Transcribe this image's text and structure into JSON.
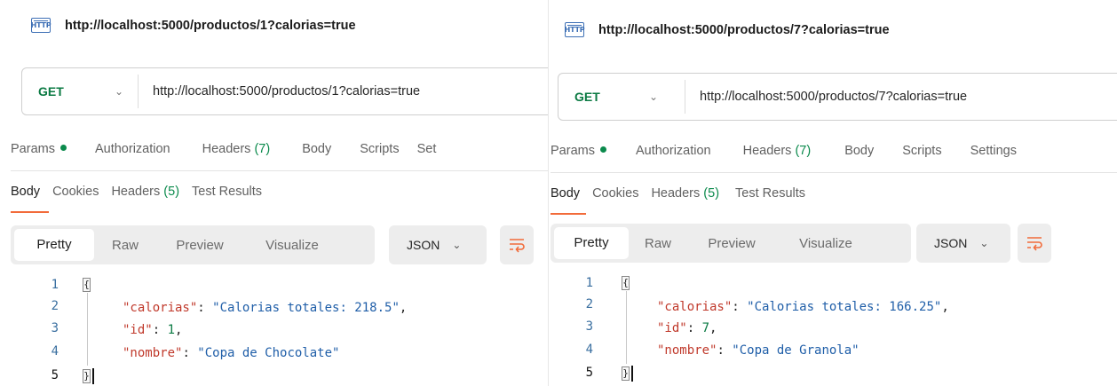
{
  "left": {
    "title": "http://localhost:5000/productos/1?calorias=true",
    "method": "GET",
    "url": "http://localhost:5000/productos/1?calorias=true",
    "request_tabs": {
      "params": "Params",
      "authorization": "Authorization",
      "headers": "Headers",
      "headers_count": "(7)",
      "body": "Body",
      "scripts": "Scripts",
      "settings": "Set"
    },
    "response_tabs": {
      "body": "Body",
      "cookies": "Cookies",
      "headers": "Headers",
      "headers_count": "(5)",
      "test_results": "Test Results"
    },
    "view_modes": [
      "Pretty",
      "Raw",
      "Preview",
      "Visualize"
    ],
    "format": "JSON",
    "line_numbers": [
      "1",
      "2",
      "3",
      "4",
      "5"
    ],
    "json": {
      "open": "{",
      "k_calorias": "\"calorias\"",
      "v_calorias": "\"Calorias totales: 218.5\"",
      "k_id": "\"id\"",
      "v_id": "1",
      "k_nombre": "\"nombre\"",
      "v_nombre": "\"Copa de Chocolate\"",
      "close": "}"
    }
  },
  "right": {
    "title": "http://localhost:5000/productos/7?calorias=true",
    "method": "GET",
    "url": "http://localhost:5000/productos/7?calorias=true",
    "request_tabs": {
      "params": "Params",
      "authorization": "Authorization",
      "headers": "Headers",
      "headers_count": "(7)",
      "body": "Body",
      "scripts": "Scripts",
      "settings": "Settings"
    },
    "response_tabs": {
      "body": "Body",
      "cookies": "Cookies",
      "headers": "Headers",
      "headers_count": "(5)",
      "test_results": "Test Results"
    },
    "view_modes": [
      "Pretty",
      "Raw",
      "Preview",
      "Visualize"
    ],
    "format": "JSON",
    "line_numbers": [
      "1",
      "2",
      "3",
      "4",
      "5"
    ],
    "json": {
      "open": "{",
      "k_calorias": "\"calorias\"",
      "v_calorias": "\"Calorias totales: 166.25\"",
      "k_id": "\"id\"",
      "v_id": "7",
      "k_nombre": "\"nombre\"",
      "v_nombre": "\"Copa de Granola\"",
      "close": "}"
    }
  },
  "icons": {
    "http": "http-icon",
    "chevron": "chevron-down-icon",
    "wrap": "wrap-lines-icon"
  },
  "colors": {
    "method_get": "#0b7a43",
    "accent_underline": "#f26b3a",
    "count_green": "#0b8a4c",
    "json_key": "#c0392b",
    "json_string": "#1f5ea8"
  }
}
